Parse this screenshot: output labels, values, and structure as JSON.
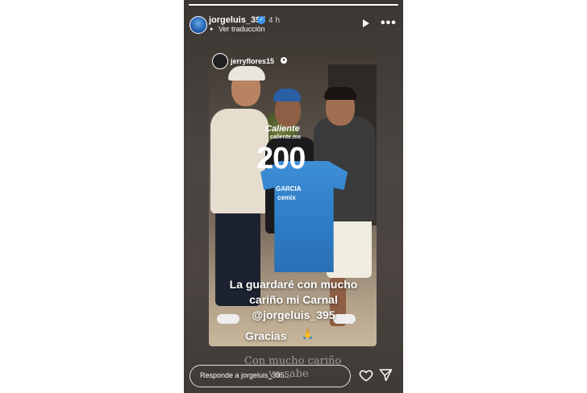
{
  "header": {
    "username": "jorgeluis_395",
    "verified_mark": "✓",
    "time": "4 h",
    "translate_label": "Ver traducción",
    "progress_fraction": 1.0
  },
  "icons": {
    "avatar": "avatar",
    "verified": "verified-badge-icon",
    "translate": "translate-dot-icon",
    "play": "play-icon",
    "more": "more-options-icon",
    "heart": "heart-icon",
    "send": "send-icon"
  },
  "repost": {
    "username": "jerryflores15",
    "verified_mark": "●"
  },
  "jersey": {
    "sponsor": "Caliente",
    "sponsor_sub": "caliente.mx",
    "number": "200",
    "name": "GARCIA",
    "sponsor_bottom": "cemix"
  },
  "caption": {
    "line1": "La guardaré con mucho",
    "line2": "cariño mi Carnal",
    "line3": "@jorgeluis_395",
    "line4": "Gracias"
  },
  "sticker": {
    "line1": "Con mucho cariño",
    "line2": "ya sabe"
  },
  "footer": {
    "reply_placeholder": "Responde a jorgeluis_395..."
  },
  "colors": {
    "accent_verified": "#3897f0",
    "jersey_blue": "#2d7bc4"
  }
}
